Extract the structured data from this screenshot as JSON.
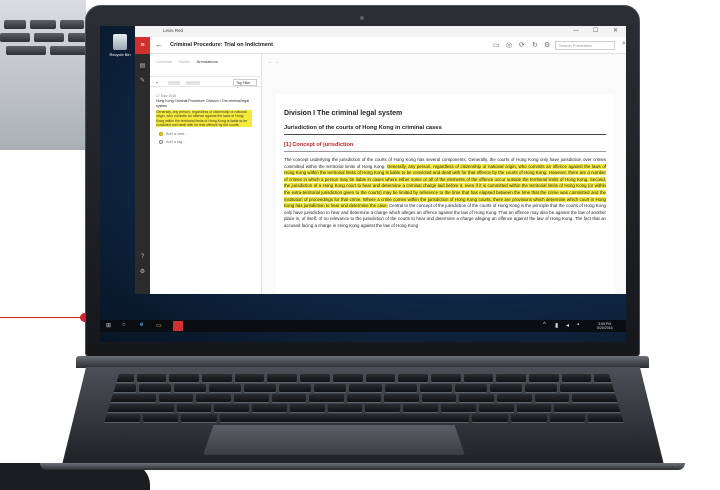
{
  "desktop": {
    "recycle_bin_label": "Recycle Bin"
  },
  "window": {
    "app_title": "Lexis Red",
    "controls": {
      "minimize": "—",
      "maximize": "☐",
      "close": "✕"
    }
  },
  "appbar": {
    "back_glyph": "←",
    "document_title": "Criminal Procedure: Trial on Indictment",
    "search_placeholder": "Search Publication",
    "search_glyph": "⌕"
  },
  "left_pane": {
    "tabs": [
      "Contents",
      "Notes"
    ],
    "selected_tab_label": "Annotations",
    "tag_filter_label": "Tag Filter",
    "note_date": "17 May 2016",
    "note_reference": "Hong Kong Criminal Procedure: Division I The criminal legal system",
    "note_excerpt": "Generally, any person, regardless of citizenship or national origin, who commits an offence against the laws of Hong Kong within the territorial limits of Hong Kong is liable to be convicted and dealt with for that offence by the courts",
    "checklist": [
      {
        "label": "Add a note...",
        "checked": true
      },
      {
        "label": "Add a tag...",
        "checked": false
      }
    ]
  },
  "document": {
    "nav": "← →",
    "heading": "Division I The criminal legal system",
    "subheading": "Jurisdiction of the courts of Hong Kong in criminal cases",
    "section": "[1] Concept of jurisdiction",
    "para_before": "The concept underlying the jurisdiction of the courts of Hong Kong has several components. Generally, the courts of Hong Kong only have jurisdiction over crimes committed within the territorial limits of Hong Kong. ",
    "para_highlight": "Generally, any person, regardless of citizenship or national origin, who commits an offence against the laws of Hong Kong within the territorial limits of Hong Kong is liable to be convicted and dealt with for that offence by the courts of Hong Kong. However, there are a number of crimes in which a person may be liable in cases where either some or all of the elements of the offence occur outside the territorial limits of Hong Kong. Second, the jurisdiction of a Hong Kong court to hear and determine a criminal charge laid before it, even if it is committed within the territorial limits of Hong Kong (or within the extra-territorial jurisdiction given to the courts) may be limited by reference to the time that has elapsed between the time that the crime was committed and the institution of proceedings for that crime. Where a crime comes within the jurisdiction of Hong Kong courts, there are provisions which determine which court in Hong Kong has jurisdiction to hear and determine the case.",
    "para_after": " Central to the concept of the jurisdiction of the courts of Hong Kong is the principle that the courts of Hong Kong only have jurisdiction to hear and determine a charge which alleges an offence against the law of Hong Kong. That an offence may also be against the law of another place is, of itself, of no relevance to the jurisdiction of the courts to hear and determine a charge alleging an offence against the law of Hong Kong. The fact that an accused facing a charge in Hong Kong against the law of Hong Kong"
  },
  "taskbar": {
    "start_glyph": "⊞",
    "search_glyph": "○",
    "edge_glyph": "e",
    "explorer_glyph": "▭",
    "time": "3:55 PM",
    "date": "5/20/2016"
  }
}
